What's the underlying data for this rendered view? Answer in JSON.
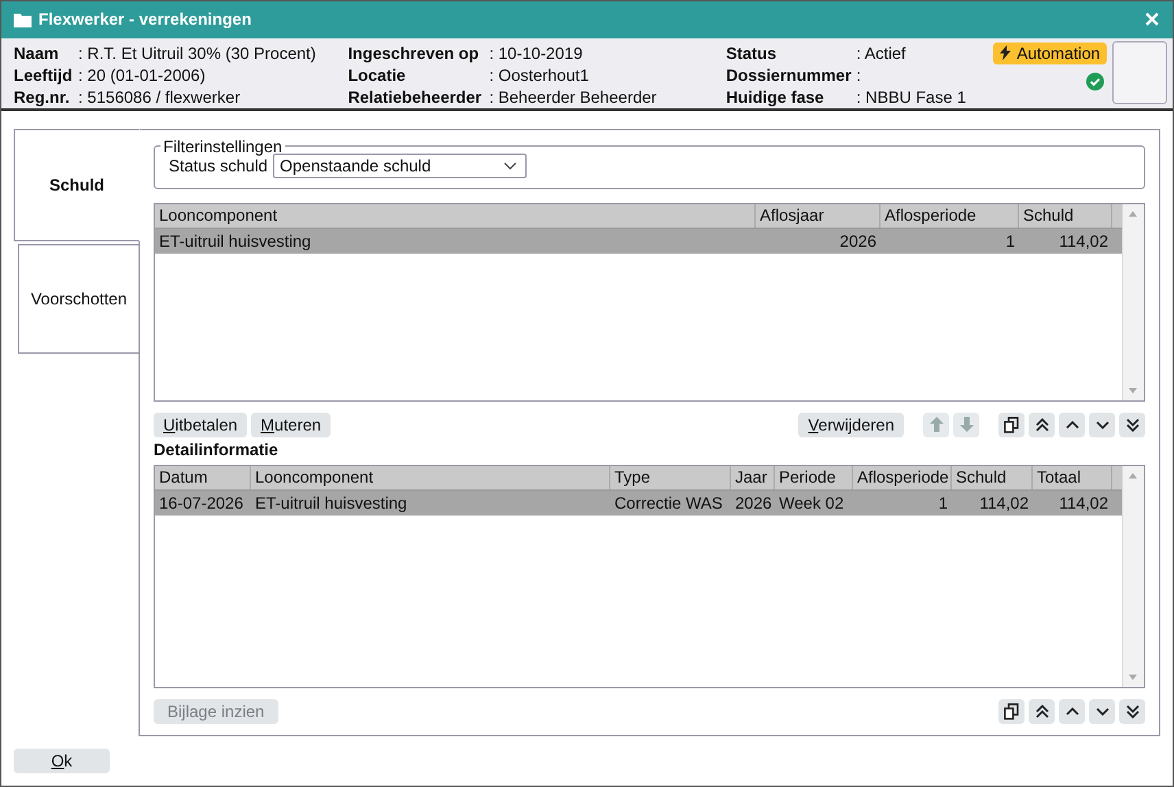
{
  "window": {
    "title": "Flexwerker - verrekeningen"
  },
  "info_columns": [
    [
      {
        "label": "Naam",
        "value": ": R.T. Et Uitruil 30% (30 Procent)"
      },
      {
        "label": "Leeftijd",
        "value": ": 20 (01-01-2006)"
      },
      {
        "label": "Reg.nr.",
        "value": ": 5156086 / flexwerker"
      }
    ],
    [
      {
        "label": "Ingeschreven op",
        "value": ": 10-10-2019"
      },
      {
        "label": "Locatie",
        "value": ": Oosterhout1"
      },
      {
        "label": "Relatiebeheerder",
        "value": ": Beheerder Beheerder"
      }
    ],
    [
      {
        "label": "Status",
        "value": ": Actief"
      },
      {
        "label": "Dossiernummer",
        "value": ":"
      },
      {
        "label": "Huidige fase",
        "value": ": NBBU Fase 1"
      }
    ]
  ],
  "automation_badge": "Automation",
  "tabs": [
    {
      "label": "Schuld",
      "selected": true
    },
    {
      "label": "Voorschotten",
      "selected": false
    }
  ],
  "filter": {
    "legend": "Filterinstellingen",
    "label": "Status schuld",
    "value": "Openstaande schuld"
  },
  "debt_table": {
    "columns": [
      "Looncomponent",
      "Aflosjaar",
      "Aflosperiode",
      "Schuld"
    ],
    "rows": [
      {
        "selected": true,
        "cells": [
          "ET-uitruil huisvesting",
          "2026",
          "1",
          "114,02"
        ]
      }
    ]
  },
  "action_buttons": [
    {
      "label": "Uitbetalen",
      "disabled": false
    },
    {
      "label": "Muteren",
      "disabled": false
    }
  ],
  "delete_button": {
    "label": "Verwijderen",
    "disabled": false
  },
  "detail": {
    "title": "Detailinformatie",
    "columns": [
      "Datum",
      "Looncomponent",
      "Type",
      "Jaar",
      "Periode",
      "Aflosperiode",
      "Schuld",
      "Totaal"
    ],
    "rows": [
      {
        "selected": true,
        "cells": [
          "16-07-2026",
          "ET-uitruil huisvesting",
          "Correctie WAS",
          "2026",
          "Week 02",
          "1",
          "114,02",
          "114,02"
        ]
      }
    ]
  },
  "attachment_button": {
    "label": "Bijlage inzien",
    "disabled": true
  },
  "ok_button": {
    "label": "Ok",
    "disabled": false
  }
}
